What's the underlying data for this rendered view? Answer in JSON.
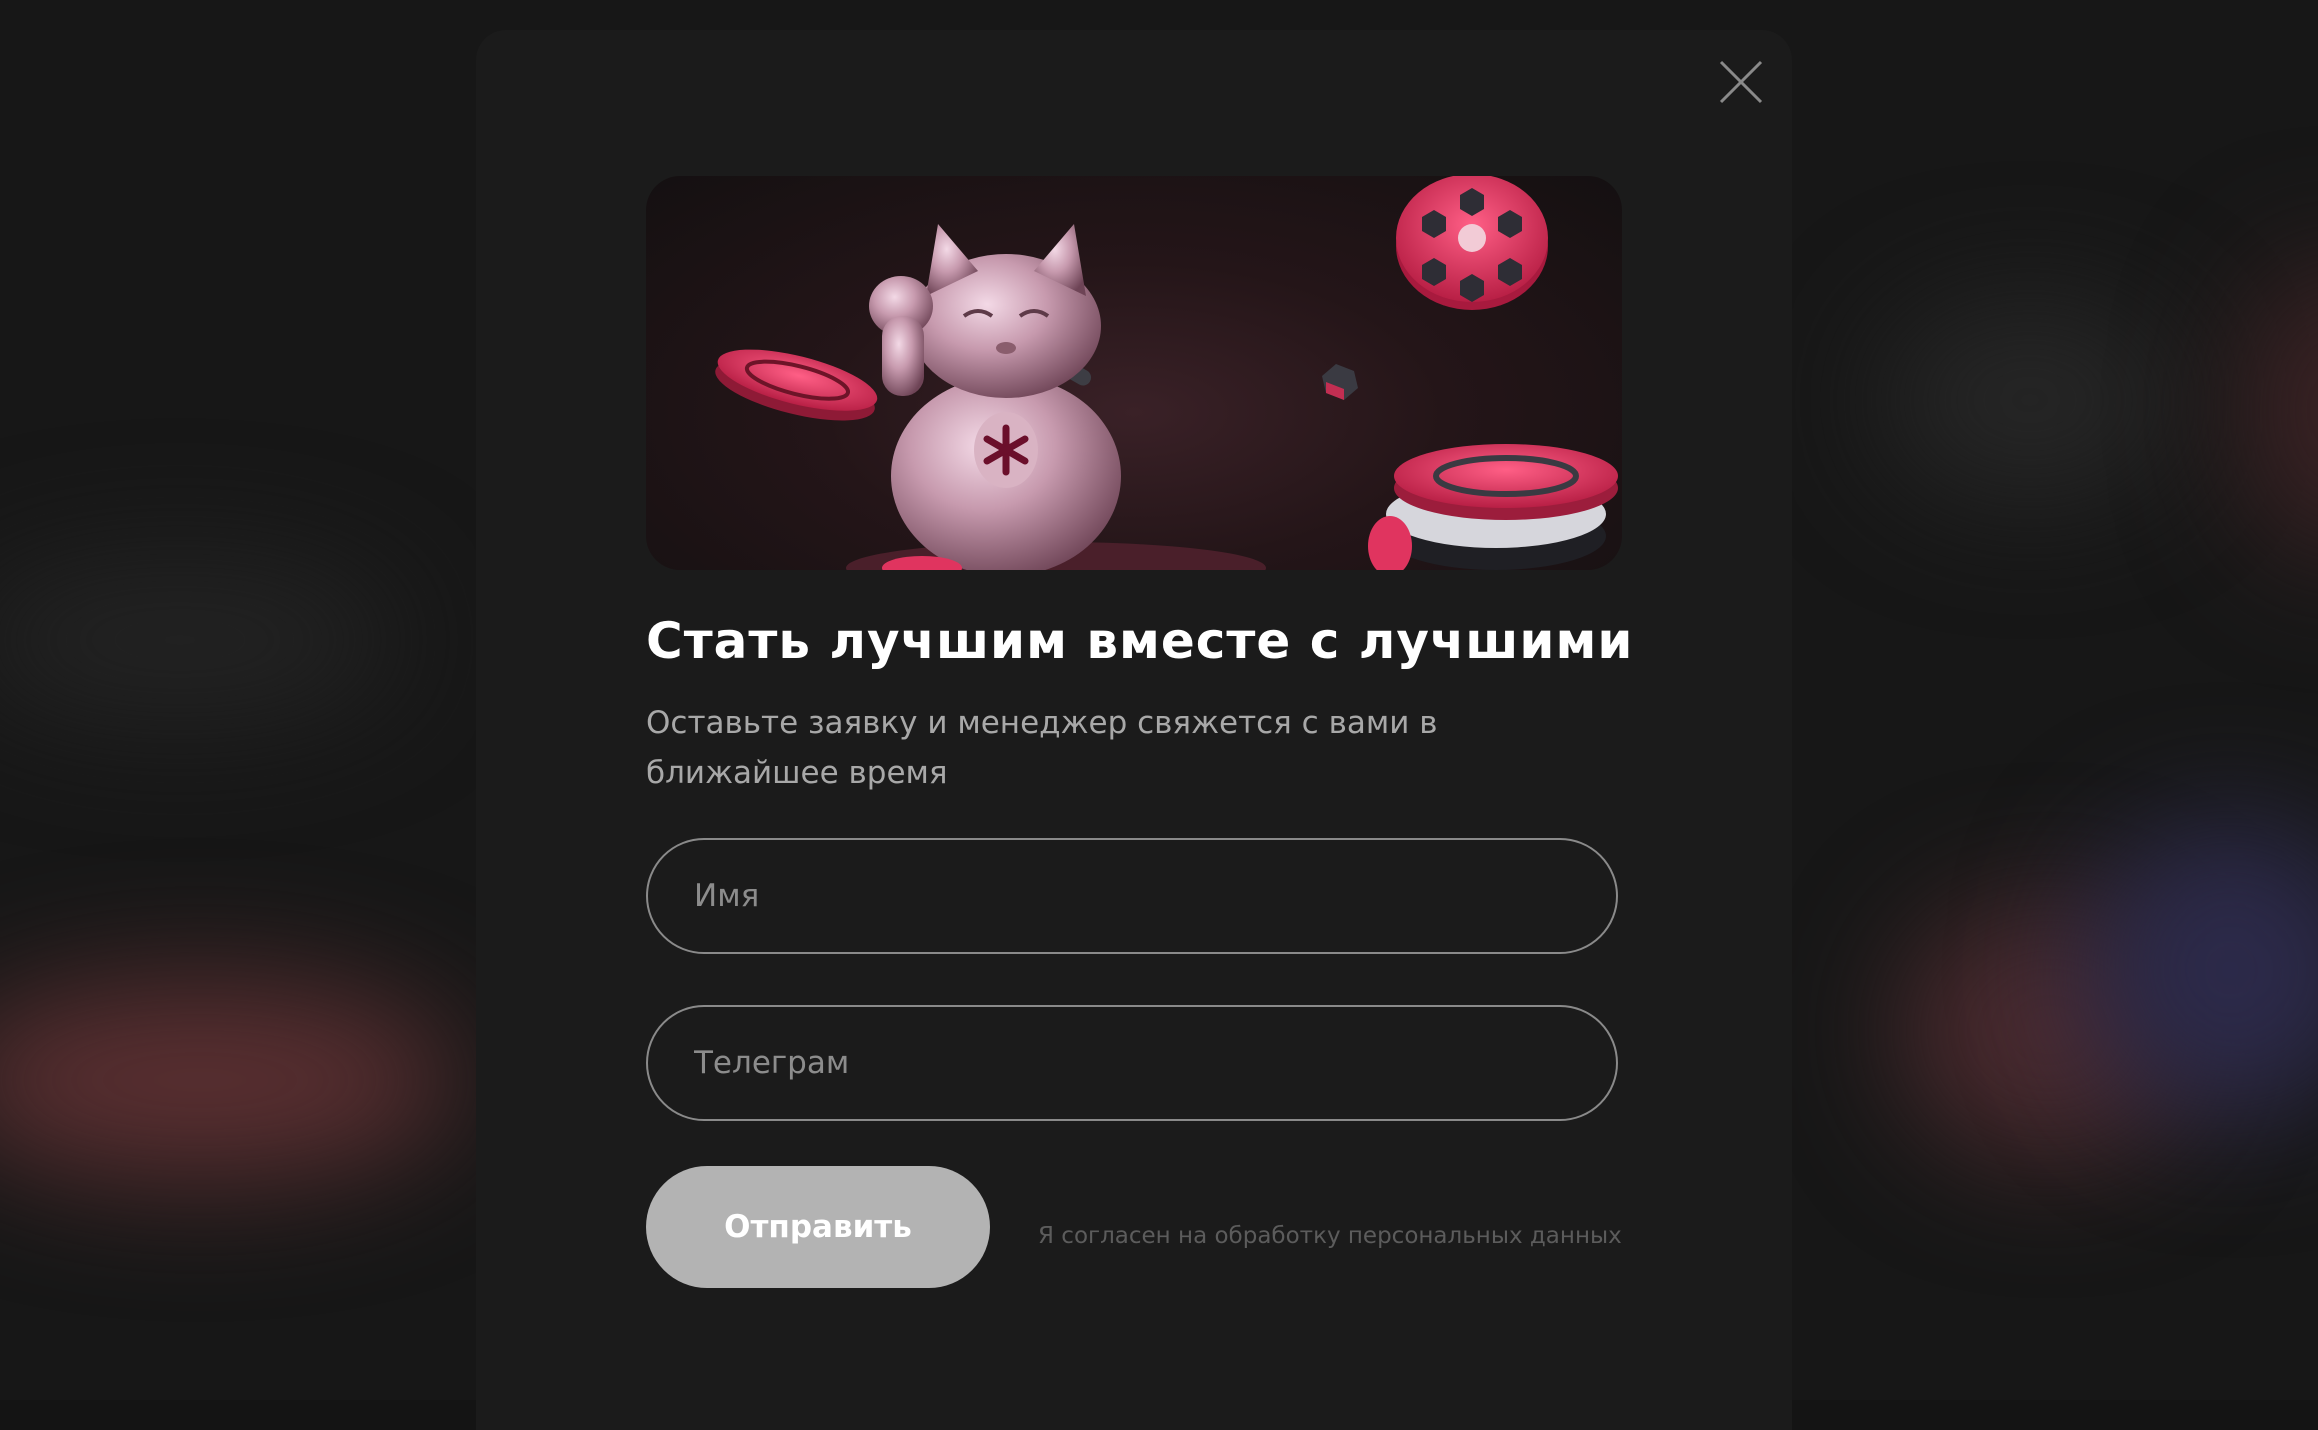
{
  "modal": {
    "title": "Стать лучшим вместе с лучшими",
    "subtitle": "Оставьте заявку и менеджер свяжется с вами в ближайшее время",
    "close_icon": "close-icon",
    "hero_image": "lucky-cat-casino-chips-illustration"
  },
  "form": {
    "name_placeholder": "Имя",
    "name_value": "",
    "telegram_placeholder": "Телеграм",
    "telegram_value": "",
    "submit_label": "Отправить",
    "consent_text": "Я согласен на обработку персональных данных"
  },
  "colors": {
    "overlay_bg": "#171717",
    "modal_bg": "#1b1b1b",
    "button_bg": "#b3b3b3",
    "accent_pink": "#e0345f"
  }
}
